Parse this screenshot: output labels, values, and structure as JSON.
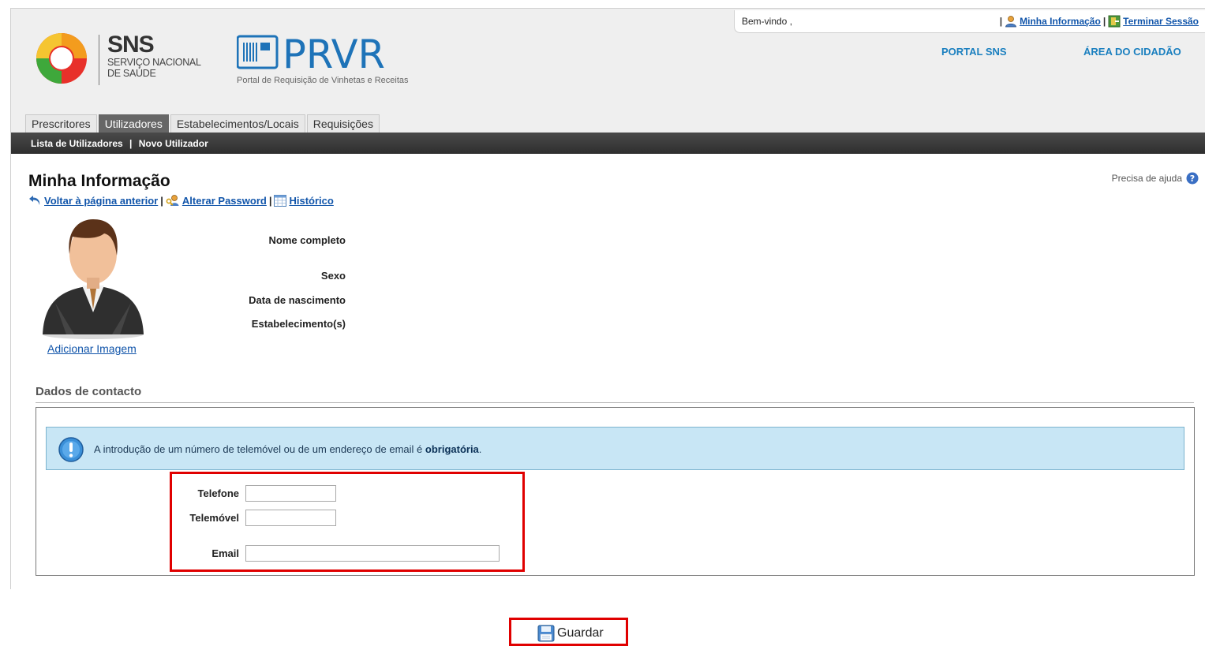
{
  "header": {
    "sns_title": "SNS",
    "sns_sub1": "SERVIÇO NACIONAL",
    "sns_sub2": "DE SAÚDE",
    "prvr_title": "PRVR",
    "prvr_subtitle": "Portal de Requisição de Vinhetas e Receitas",
    "welcome": "Bem-vindo ,",
    "sep1": "|",
    "minha_info_link": "Minha Informação",
    "sep2": "|",
    "terminar_link": "Terminar Sessão",
    "portal_sns": "PORTAL SNS",
    "area_cidadao": "ÁREA DO CIDADÃO",
    "colors": {
      "accent": "#1a7fbf",
      "link": "#1155aa"
    }
  },
  "tabs": [
    {
      "label": "Prescritores",
      "active": false
    },
    {
      "label": "Utilizadores",
      "active": true
    },
    {
      "label": "Estabelecimentos/Locais",
      "active": false
    },
    {
      "label": "Requisições",
      "active": false
    }
  ],
  "subnav": {
    "lista": "Lista de Utilizadores",
    "sep": "|",
    "novo": "Novo Utilizador"
  },
  "page": {
    "title": "Minha Informação",
    "help": "Precisa de ajuda",
    "back_link": "Voltar à página anterior",
    "sep1": "|",
    "password_link": "Alterar Password",
    "sep2": "|",
    "history_link": "Histórico",
    "add_image": "Adicionar Imagem"
  },
  "info": {
    "nome_label": "Nome completo",
    "sexo_label": "Sexo",
    "nascimento_label": "Data de nascimento",
    "estabelecimento_label": "Estabelecimento(s)"
  },
  "contact": {
    "title": "Dados de contacto",
    "notice_text": "A introdução de um número de telemóvel ou de um endereço de email é",
    "notice_bold": "obrigatória",
    "notice_end": ".",
    "telefone_label": "Telefone",
    "telefone_value": "",
    "telemovel_label": "Telemóvel",
    "telemovel_value": "",
    "email_label": "Email",
    "email_value": ""
  },
  "save_label": "Guardar",
  "icons": [
    "sns-logo-icon",
    "prvr-logo-icon",
    "user-icon",
    "logout-icon",
    "help-icon",
    "back-arrow-icon",
    "key-user-icon",
    "calendar-icon",
    "avatar-icon",
    "info-icon",
    "save-disk-icon"
  ]
}
